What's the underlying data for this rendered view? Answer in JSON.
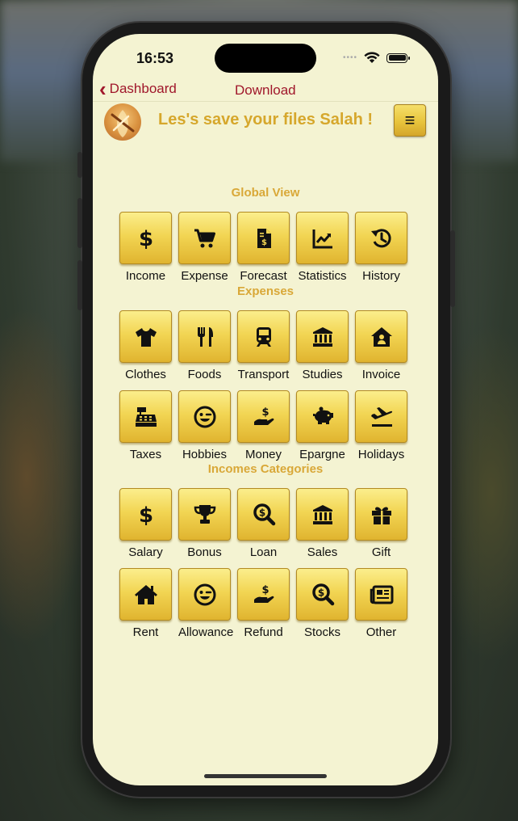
{
  "status_bar": {
    "time": "16:53"
  },
  "nav": {
    "back_label": "Dashboard",
    "title": "Download"
  },
  "header": {
    "greeting": "Les's save your files Salah !",
    "menu_icon": "hamburger-icon"
  },
  "sections": {
    "global": {
      "title": "Global View",
      "items": [
        {
          "label": "Income",
          "icon": "dollar-icon"
        },
        {
          "label": "Expense",
          "icon": "cart-icon"
        },
        {
          "label": "Forecast",
          "icon": "invoice-icon"
        },
        {
          "label": "Statistics",
          "icon": "chart-icon"
        },
        {
          "label": "History",
          "icon": "history-icon"
        }
      ]
    },
    "expenses": {
      "title": "Expenses",
      "items": [
        {
          "label": "Clothes",
          "icon": "shirt-icon"
        },
        {
          "label": "Foods",
          "icon": "utensils-icon"
        },
        {
          "label": "Transport",
          "icon": "train-icon"
        },
        {
          "label": "Studies",
          "icon": "bank-icon"
        },
        {
          "label": "Invoice",
          "icon": "house-user-icon"
        },
        {
          "label": "Taxes",
          "icon": "cash-register-icon"
        },
        {
          "label": "Hobbies",
          "icon": "wink-icon"
        },
        {
          "label": "Money",
          "icon": "hand-dollar-icon"
        },
        {
          "label": "Epargne",
          "icon": "piggy-bank-icon"
        },
        {
          "label": "Holidays",
          "icon": "plane-icon"
        }
      ]
    },
    "incomes": {
      "title": "Incomes Categories",
      "items": [
        {
          "label": "Salary",
          "icon": "dollar-icon"
        },
        {
          "label": "Bonus",
          "icon": "trophy-icon"
        },
        {
          "label": "Loan",
          "icon": "search-dollar-icon"
        },
        {
          "label": "Sales",
          "icon": "bank-icon"
        },
        {
          "label": "Gift",
          "icon": "gift-icon"
        },
        {
          "label": "Rent",
          "icon": "home-icon"
        },
        {
          "label": "Allowance",
          "icon": "wink-icon"
        },
        {
          "label": "Refund",
          "icon": "hand-dollar-icon"
        },
        {
          "label": "Stocks",
          "icon": "search-dollar-icon"
        },
        {
          "label": "Other",
          "icon": "newspaper-icon"
        }
      ]
    }
  },
  "colors": {
    "accent": "#a0172b",
    "section": "#d9a838",
    "button": "#f2d553",
    "background": "#f4f3d2"
  }
}
